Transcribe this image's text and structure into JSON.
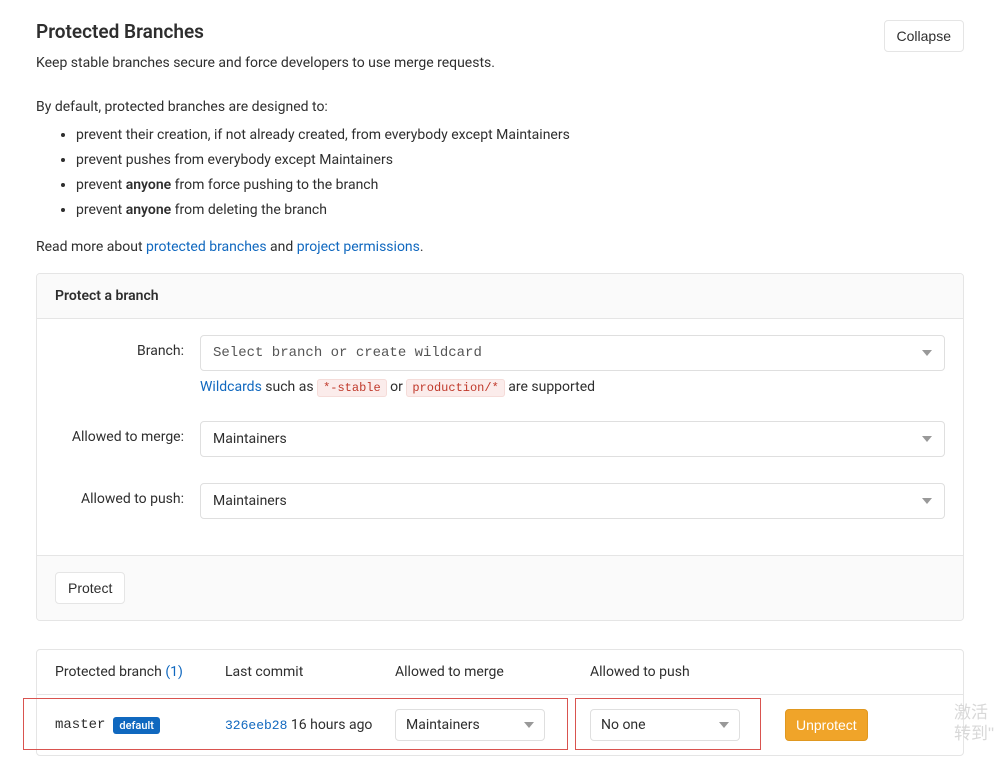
{
  "header": {
    "title": "Protected Branches",
    "collapse_btn": "Collapse",
    "subtitle": "Keep stable branches secure and force developers to use merge requests."
  },
  "intro": {
    "lead": "By default, protected branches are designed to:",
    "b1_a": "prevent their creation, if not already created, from everybody except Maintainers",
    "b2_a": "prevent pushes from everybody except Maintainers",
    "b3_a": "prevent ",
    "b3_b": "anyone",
    "b3_c": " from force pushing to the branch",
    "b4_a": "prevent ",
    "b4_b": "anyone",
    "b4_c": " from deleting the branch",
    "readmore_a": "Read more about ",
    "readmore_link1": "protected branches",
    "readmore_mid": " and ",
    "readmore_link2": "project permissions",
    "readmore_end": "."
  },
  "panel": {
    "title": "Protect a branch",
    "branch_label": "Branch:",
    "branch_placeholder": "Select branch or create wildcard",
    "help_a": "Wildcards",
    "help_b": " such as ",
    "help_code1": "*-stable",
    "help_c": " or ",
    "help_code2": "production/*",
    "help_d": " are supported",
    "merge_label": "Allowed to merge:",
    "merge_value": "Maintainers",
    "push_label": "Allowed to push:",
    "push_value": "Maintainers",
    "protect_btn": "Protect"
  },
  "table": {
    "col1_a": "Protected branch ",
    "col1_count": "(1)",
    "col2": "Last commit",
    "col3": "Allowed to merge",
    "col4": "Allowed to push",
    "row": {
      "branch": "master",
      "badge": "default",
      "commit_hash": "326eeb28",
      "commit_time": " 16 hours ago",
      "merge_value": "Maintainers",
      "push_value": "No one",
      "unprotect_btn": "Unprotect"
    }
  },
  "watermark": {
    "l1": "激活",
    "l2": "转到\""
  }
}
